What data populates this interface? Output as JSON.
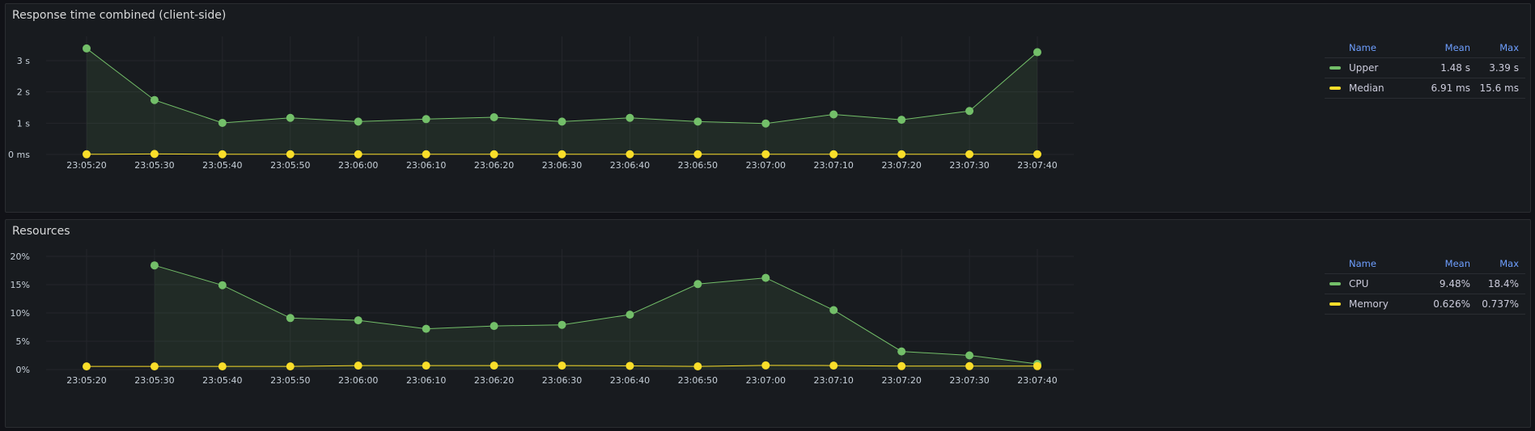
{
  "panels": [
    {
      "title": "Response time combined (client-side)",
      "legend": {
        "headers": {
          "name": "Name",
          "mean": "Mean",
          "max": "Max"
        },
        "rows": [
          {
            "name": "Upper",
            "mean": "1.48 s",
            "max": "3.39 s",
            "color": "#73bf69"
          },
          {
            "name": "Median",
            "mean": "6.91 ms",
            "max": "15.6 ms",
            "color": "#fade2a"
          }
        ]
      }
    },
    {
      "title": "Resources",
      "legend": {
        "headers": {
          "name": "Name",
          "mean": "Mean",
          "max": "Max"
        },
        "rows": [
          {
            "name": "CPU",
            "mean": "9.48%",
            "max": "18.4%",
            "color": "#73bf69"
          },
          {
            "name": "Memory",
            "mean": "0.626%",
            "max": "0.737%",
            "color": "#fade2a"
          }
        ]
      }
    }
  ],
  "chart_data": [
    {
      "type": "line",
      "title": "Response time combined (client-side)",
      "x_ticks": [
        "23:05:20",
        "23:05:30",
        "23:05:40",
        "23:05:50",
        "23:06:00",
        "23:06:10",
        "23:06:20",
        "23:06:30",
        "23:06:40",
        "23:06:50",
        "23:07:00",
        "23:07:10",
        "23:07:20",
        "23:07:30",
        "23:07:40"
      ],
      "y_ticks": [
        "0 ms",
        "1 s",
        "2 s",
        "3 s"
      ],
      "ylim": [
        0,
        3.6
      ],
      "y_unit": "s",
      "grid": true,
      "legend_position": "right",
      "series": [
        {
          "name": "Upper",
          "color": "#73bf69",
          "fill": true,
          "x": [
            "23:05:20",
            "23:05:30",
            "23:05:40",
            "23:05:50",
            "23:06:00",
            "23:06:10",
            "23:06:20",
            "23:06:30",
            "23:06:40",
            "23:06:50",
            "23:07:00",
            "23:07:10",
            "23:07:20",
            "23:07:30",
            "23:07:40"
          ],
          "values": [
            3.39,
            1.74,
            1.01,
            1.17,
            1.05,
            1.13,
            1.19,
            1.05,
            1.17,
            1.05,
            0.99,
            1.28,
            1.11,
            1.39,
            3.27
          ]
        },
        {
          "name": "Median",
          "color": "#fade2a",
          "fill": false,
          "x": [
            "23:05:20",
            "23:05:30",
            "23:05:40",
            "23:05:50",
            "23:06:00",
            "23:06:10",
            "23:06:20",
            "23:06:30",
            "23:06:40",
            "23:06:50",
            "23:07:00",
            "23:07:10",
            "23:07:20",
            "23:07:30",
            "23:07:40"
          ],
          "values": [
            0.005,
            0.0156,
            0.006,
            0.007,
            0.006,
            0.007,
            0.006,
            0.007,
            0.006,
            0.007,
            0.006,
            0.006,
            0.007,
            0.006,
            0.006
          ]
        }
      ]
    },
    {
      "type": "line",
      "title": "Resources",
      "x_ticks": [
        "23:05:20",
        "23:05:30",
        "23:05:40",
        "23:05:50",
        "23:06:00",
        "23:06:10",
        "23:06:20",
        "23:06:30",
        "23:06:40",
        "23:06:50",
        "23:07:00",
        "23:07:10",
        "23:07:20",
        "23:07:30",
        "23:07:40"
      ],
      "y_ticks": [
        "0%",
        "5%",
        "10%",
        "15%",
        "20%"
      ],
      "ylim": [
        0,
        21
      ],
      "y_unit": "%",
      "grid": true,
      "legend_position": "right",
      "series": [
        {
          "name": "CPU",
          "color": "#73bf69",
          "fill": true,
          "x": [
            "23:05:30",
            "23:05:40",
            "23:05:50",
            "23:06:00",
            "23:06:10",
            "23:06:20",
            "23:06:30",
            "23:06:40",
            "23:06:50",
            "23:07:00",
            "23:07:10",
            "23:07:20",
            "23:07:30",
            "23:07:40"
          ],
          "values": [
            18.4,
            14.9,
            9.1,
            8.7,
            7.2,
            7.7,
            7.9,
            9.7,
            15.1,
            16.2,
            10.5,
            3.2,
            2.5,
            1.0
          ]
        },
        {
          "name": "Memory",
          "color": "#fade2a",
          "fill": false,
          "x": [
            "23:05:20",
            "23:05:30",
            "23:05:40",
            "23:05:50",
            "23:06:00",
            "23:06:10",
            "23:06:20",
            "23:06:30",
            "23:06:40",
            "23:06:50",
            "23:07:00",
            "23:07:10",
            "23:07:20",
            "23:07:30",
            "23:07:40"
          ],
          "values": [
            0.55,
            0.55,
            0.55,
            0.55,
            0.7,
            0.7,
            0.7,
            0.7,
            0.65,
            0.55,
            0.737,
            0.7,
            0.6,
            0.6,
            0.6
          ]
        }
      ]
    }
  ]
}
